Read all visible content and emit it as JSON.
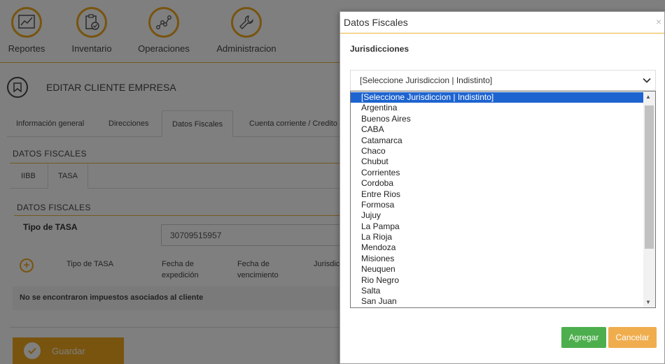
{
  "nav": [
    {
      "label": "Reportes",
      "icon": "chart-icon"
    },
    {
      "label": "Inventario",
      "icon": "clipboard-icon"
    },
    {
      "label": "Operaciones",
      "icon": "network-icon"
    },
    {
      "label": "Administracion",
      "icon": "wrench-icon"
    }
  ],
  "page": {
    "title": "EDITAR CLIENTE EMPRESA",
    "tabs": [
      "Información general",
      "Direcciones",
      "Datos Fiscales",
      "Cuenta corriente / Credito"
    ],
    "section_title": "DATOS FISCALES",
    "subtabs": [
      "IIBB",
      "TASA"
    ],
    "subsection_title": "DATOS FISCALES",
    "field_label": "Tipo de TASA",
    "field_value": "30709515957",
    "table_headers": [
      "Tipo de TASA",
      "Fecha de expedición",
      "Fecha de vencimiento",
      "Jurisdic"
    ],
    "empty_message": "No se encontraron impuestos asociados al cliente",
    "save_label": "Guardar"
  },
  "modal": {
    "title": "Datos Fiscales",
    "close": "×",
    "jurisdiction_label": "Jurisdicciones",
    "selected": "[Seleccione Jurisdiccion | Indistinto]",
    "options": [
      "[Seleccione Jurisdiccion | Indistinto]",
      "Argentina",
      "Buenos Aires",
      "CABA",
      "Catamarca",
      "Chaco",
      "Chubut",
      "Corrientes",
      "Cordoba",
      "Entre Rios",
      "Formosa",
      "Jujuy",
      "La Pampa",
      "La Rioja",
      "Mendoza",
      "Misiones",
      "Neuquen",
      "Rio Negro",
      "Salta",
      "San Juan"
    ],
    "add_label": "Agregar",
    "cancel_label": "Cancelar"
  }
}
